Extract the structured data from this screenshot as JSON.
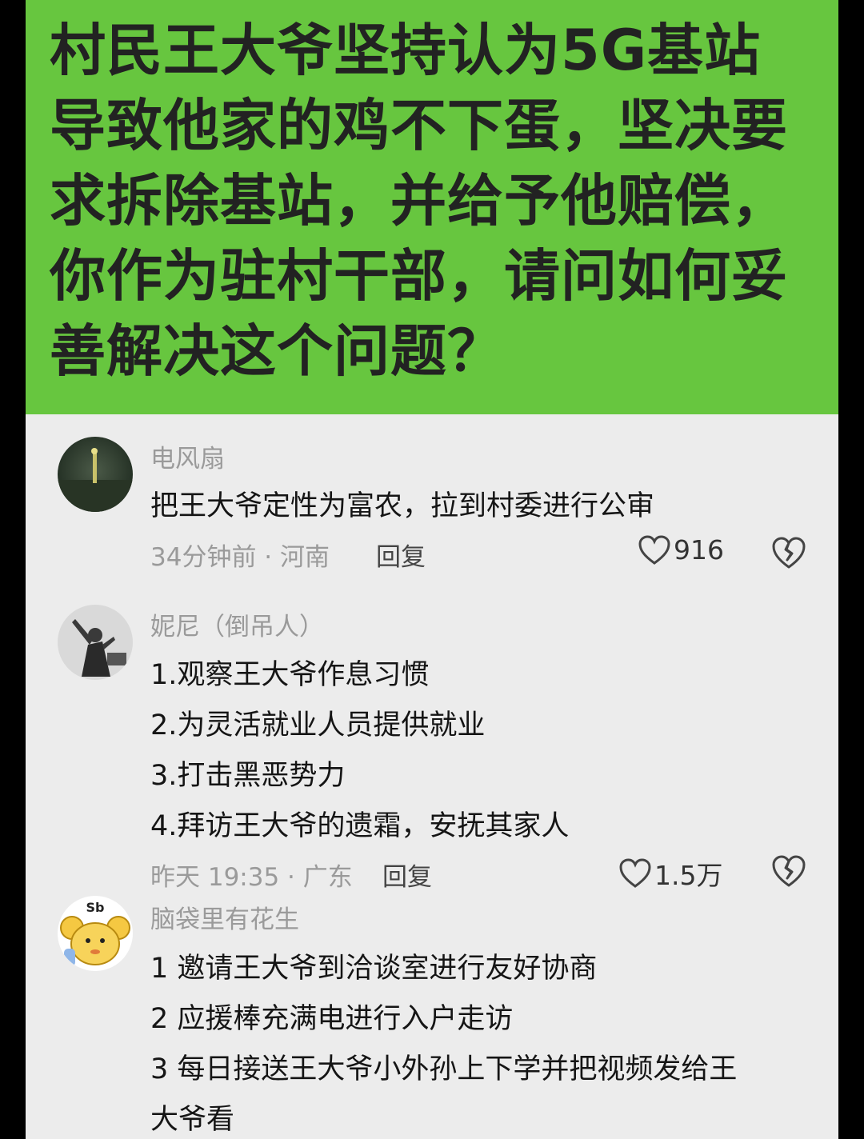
{
  "post": {
    "title": "村民王大爷坚持认为5G基站\n导致他家的鸡不下蛋，坚决要\n求拆除基站，并给予他赔偿，\n你作为驻村干部，请问如何妥\n善解决这个问题？"
  },
  "comments": [
    {
      "username": "电风扇",
      "lines": [
        "把王大爷定性为富农，拉到村委进行公审"
      ],
      "meta": "34分钟前 · 河南",
      "reply_label": "回复",
      "likes": "916"
    },
    {
      "username": "妮尼（倒吊人）",
      "lines": [
        "1.观察王大爷作息习惯",
        "2.为灵活就业人员提供就业",
        "3.打击黑恶势力",
        "4.拜访王大爷的遗霜，安抚其家人"
      ],
      "meta": "昨天 19:35 · 广东",
      "reply_label": "回复",
      "likes": "1.5万"
    },
    {
      "username": "脑袋里有花生",
      "avatar_badge": "Sb",
      "lines": [
        "1 邀请王大爷到洽谈室进行友好协商",
        "2 应援棒充满电进行入户走访",
        "3 每日接送王大爷小外孙上下学并把视频发给王",
        "大爷看"
      ]
    }
  ],
  "colors": {
    "banner": "#67c63f",
    "background": "#ececec",
    "outer": "#000000"
  },
  "icons": [
    "heart-icon",
    "broken-heart-icon"
  ]
}
